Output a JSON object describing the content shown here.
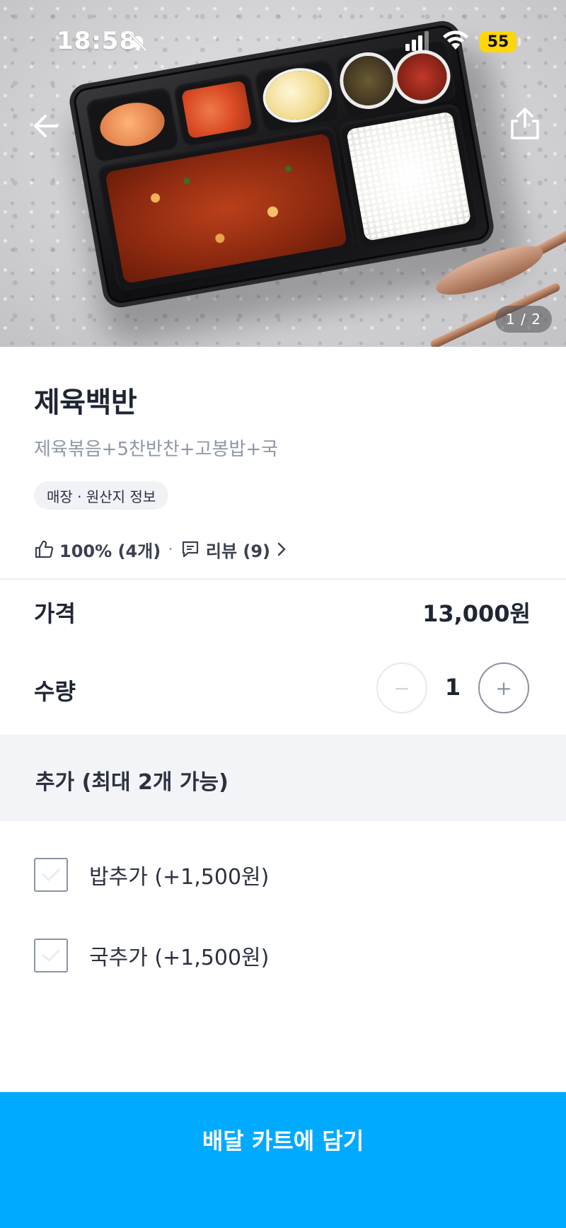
{
  "status_bar": {
    "time": "18:58",
    "battery": "55",
    "icons": [
      "bell-slash-icon",
      "cellular-signal-icon",
      "wifi-icon",
      "battery-icon"
    ]
  },
  "hero": {
    "page_indicator": "1 / 2",
    "icons": {
      "back": "arrow-left-icon",
      "share": "share-icon"
    }
  },
  "product": {
    "title": "제육백반",
    "subtitle": "제육볶음+5찬반찬+고봉밥+국",
    "store_info_chip": "매장 · 원산지 정보",
    "rating": "100% (4개)",
    "separator": "·",
    "reviews": "리뷰 (9)"
  },
  "price": {
    "label": "가격",
    "value": "13,000원"
  },
  "quantity": {
    "label": "수량",
    "minus": "−",
    "value": "1",
    "plus": "+"
  },
  "addons": {
    "title": "추가 (최대 2개 가능)",
    "options": [
      {
        "label": "밥추가 (+1,500원)",
        "checked": false
      },
      {
        "label": "국추가 (+1,500원)",
        "checked": false
      }
    ]
  },
  "cta": {
    "label": "배달 카트에 담기"
  },
  "colors": {
    "primary": "#00aaff",
    "text": "#1f2633",
    "muted": "#8e97a6",
    "section_bg": "#f2f4f7",
    "battery": "#ffd60a"
  }
}
